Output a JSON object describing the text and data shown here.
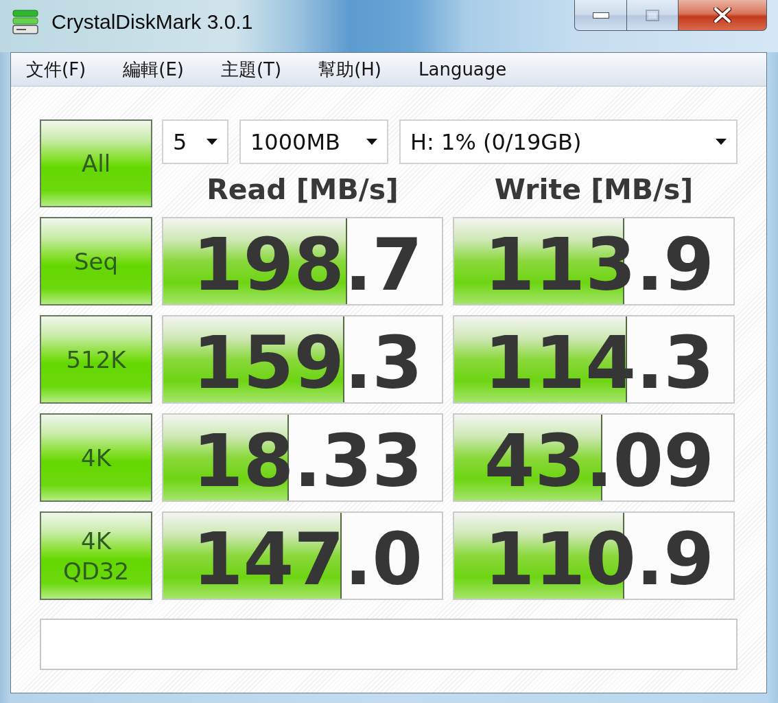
{
  "window": {
    "title": "CrystalDiskMark 3.0.1",
    "maximize": {
      "disabled": true
    }
  },
  "menu": [
    "文件(F)",
    "編輯(E)",
    "主題(T)",
    "幫助(H)",
    "Language"
  ],
  "all_button": "All",
  "dropdowns": [
    "5",
    "1000MB",
    "H: 1% (0/19GB)"
  ],
  "columns": [
    "Read [MB/s]",
    "Write [MB/s]"
  ],
  "rows": [
    {
      "label": "Seq",
      "read": {
        "value": "198.7",
        "level": 0.66
      },
      "write": {
        "value": "113.9",
        "level": 0.61
      }
    },
    {
      "label": "512K",
      "read": {
        "value": "159.3",
        "level": 0.65
      },
      "write": {
        "value": "114.3",
        "level": 0.62
      }
    },
    {
      "label": "4K",
      "read": {
        "value": "18.33",
        "level": 0.45
      },
      "write": {
        "value": "43.09",
        "level": 0.53
      }
    },
    {
      "label": "4K QD32",
      "read": {
        "value": "147.0",
        "level": 0.64
      },
      "write": {
        "value": "110.9",
        "level": 0.61
      }
    }
  ]
}
